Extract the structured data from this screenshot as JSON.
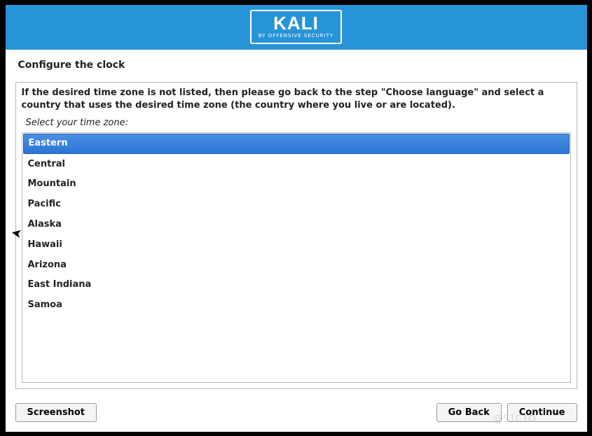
{
  "header": {
    "logo_text": "KALI",
    "logo_sub": "BY OFFENSIVE SECURITY"
  },
  "page": {
    "title": "Configure the clock",
    "instructions": "If the desired time zone is not listed, then please go back to the step \"Choose language\" and select a country that uses the desired time zone (the country where you live or are located).",
    "prompt": "Select your time zone:"
  },
  "timezones": [
    {
      "label": "Eastern",
      "selected": true
    },
    {
      "label": "Central",
      "selected": false
    },
    {
      "label": "Mountain",
      "selected": false
    },
    {
      "label": "Pacific",
      "selected": false
    },
    {
      "label": "Alaska",
      "selected": false
    },
    {
      "label": "Hawaii",
      "selected": false
    },
    {
      "label": "Arizona",
      "selected": false
    },
    {
      "label": "East Indiana",
      "selected": false
    },
    {
      "label": "Samoa",
      "selected": false
    }
  ],
  "buttons": {
    "screenshot": "Screenshot",
    "goback": "Go Back",
    "continue": "Continue"
  },
  "watermark": "@51CTO"
}
